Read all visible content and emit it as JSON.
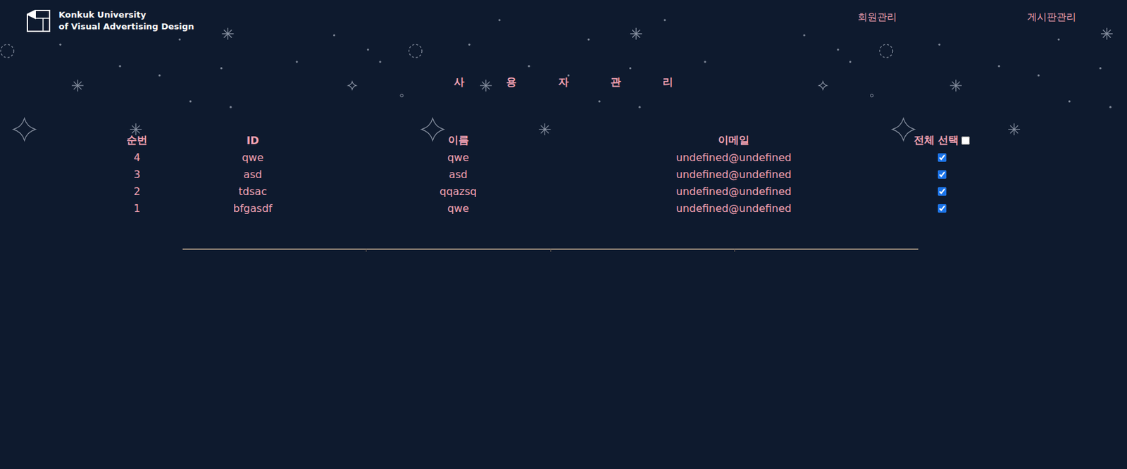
{
  "header": {
    "logo": {
      "line1": "Konkuk University",
      "line2": "of Visual Advertising Design"
    },
    "nav": [
      {
        "label": "회원관리"
      },
      {
        "label": "게시판관리"
      }
    ]
  },
  "title": "사용자관리",
  "table": {
    "columns": [
      "순번",
      "ID",
      "이름",
      "이메일"
    ],
    "select_all": {
      "label": "전체 선택",
      "checked": false
    },
    "rows": [
      {
        "no": "4",
        "id": "qwe",
        "name": "qwe",
        "email": "undefined@undefined",
        "checked": true
      },
      {
        "no": "3",
        "id": "asd",
        "name": "asd",
        "email": "undefined@undefined",
        "checked": true
      },
      {
        "no": "2",
        "id": "tdsac",
        "name": "qqazsq",
        "email": "undefined@undefined",
        "checked": true
      },
      {
        "no": "1",
        "id": "bfgasdf",
        "name": "qwe",
        "email": "undefined@undefined",
        "checked": true
      }
    ]
  }
}
